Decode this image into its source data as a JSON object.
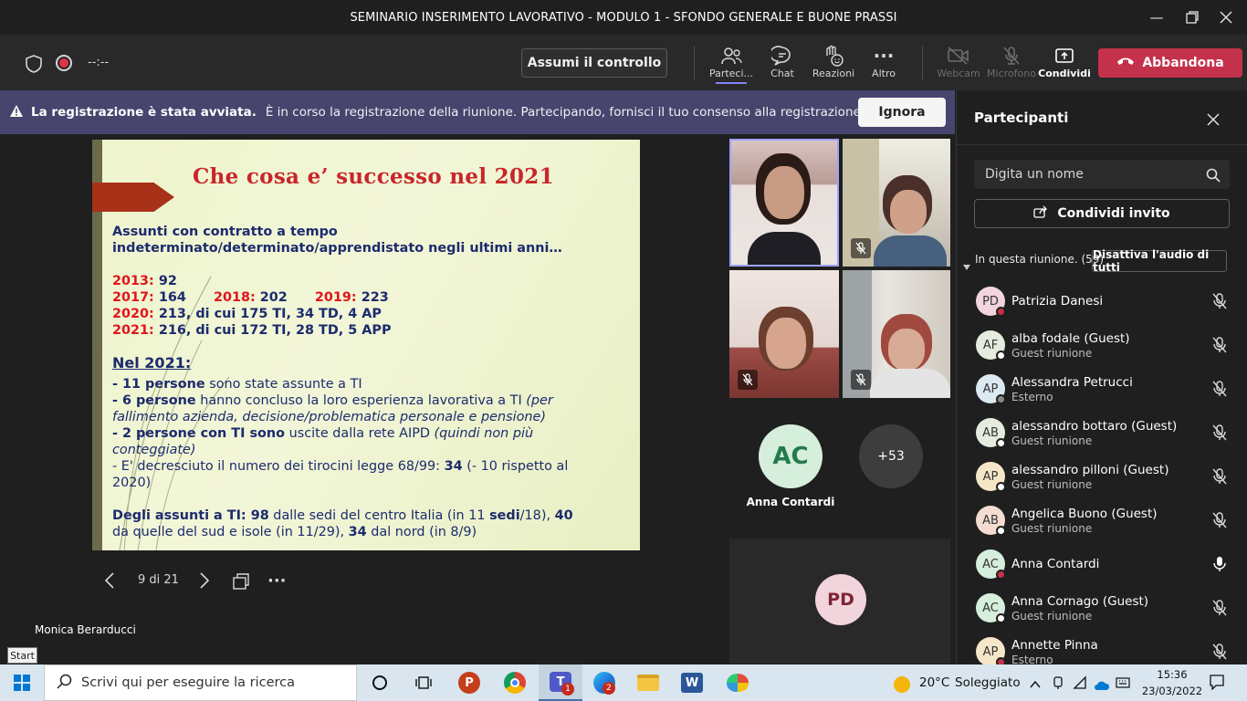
{
  "window": {
    "title": "SEMINARIO INSERIMENTO LAVORATIVO - MODULO 1 - SFONDO GENERALE E BUONE PRASSI"
  },
  "toolbar": {
    "timer": "--:--",
    "take_control": "Assumi il controllo",
    "participants": "Parteci...",
    "chat": "Chat",
    "reactions": "Reazioni",
    "more": "Altro",
    "webcam": "Webcam",
    "mic": "Microfono",
    "share": "Condividi",
    "leave": "Abbandona"
  },
  "banner": {
    "bold": "La registrazione è stata avviata.",
    "text": "È in corso la registrazione della riunione. Partecipando, fornisci il tuo consenso alla registrazione della riuni...",
    "dismiss": "Ignora"
  },
  "slide": {
    "title": "Che cosa e’ successo nel 2021",
    "intro1": "Assunti con contratto a tempo",
    "intro2": "indeterminato/determinato/apprendistato  negli ultimi anni…",
    "y2013": "2013:",
    "v2013": " 92",
    "y2017": "2017:",
    "v2017": " 164",
    "y2018": "2018:",
    "v2018": " 202",
    "y2019": "2019:",
    "v2019": " 223",
    "y2020": "2020:",
    "v2020": " 213, di cui 175 TI, 34 TD, 4 AP",
    "y2021": "2021:",
    "v2021": " 216, di cui 172 TI, 28 TD, 5 APP",
    "nel2021": "Nel 2021:",
    "l1a": "- 11 persone",
    "l1b": " sono state assunte a TI",
    "l2a": "- 6 persone",
    "l2b": " hanno concluso la loro esperienza lavorativa a TI ",
    "l2c": "(per",
    "l3": "fallimento azienda, decisione/problematica personale e pensione)",
    "l4a": "- 2 persone con TI sono",
    "l4b": " uscite dalla rete AIPD ",
    "l4c": "(quindi non più",
    "l5": "conteggiate)",
    "l6a": "- E' decresciuto il numero dei tirocini legge 68/99: ",
    "l6b": "34",
    "l6c": " (- 10 rispetto al",
    "l7": "2020)",
    "l8a": "Degli assunti a TI:",
    "l8b": "  98",
    "l8c": " dalle sedi del centro Italia (in 11 ",
    "l8d": "sedi",
    "l8e": "/18), ",
    "l8f": "40",
    "l9a": "da quelle del sud e isole (in 11/29), ",
    "l9b": "34",
    "l9c": " dal nord (in 8/9)"
  },
  "slide_controls": {
    "page": "9 di 21"
  },
  "presenter": "Monica Berarducci",
  "start_tooltip": "Start",
  "tiles": {
    "anna_initials": "AC",
    "anna_name": "Anna Contardi",
    "more": "+53",
    "pd_initials": "PD"
  },
  "panel": {
    "title": "Partecipanti",
    "search_placeholder": "Digita un nome",
    "invite": "Condividi invito",
    "in_meeting": "In questa riunione. (59)",
    "mute_all": "Disattiva l'audio di tutti",
    "people": [
      {
        "initials": "PD",
        "name": "Patrizia Danesi",
        "sub": "",
        "avatar": "#f2d5dc",
        "dot": "#c4314b",
        "mic": "off"
      },
      {
        "initials": "AF",
        "name": "alba fodale (Guest)",
        "sub": "Guest riunione",
        "avatar": "#e3ecdf",
        "dot": "#ffffff",
        "mic": "off"
      },
      {
        "initials": "AP",
        "name": "Alessandra Petrucci",
        "sub": "Esterno",
        "avatar": "#dbe9f1",
        "dot": "#8a8a8a",
        "mic": "off"
      },
      {
        "initials": "AB",
        "name": "alessandro bottaro (Guest)",
        "sub": "Guest riunione",
        "avatar": "#e3ecdf",
        "dot": "#ffffff",
        "mic": "off"
      },
      {
        "initials": "AP",
        "name": "alessandro pilloni (Guest)",
        "sub": "Guest riunione",
        "avatar": "#f6e6c8",
        "dot": "#ffffff",
        "mic": "off"
      },
      {
        "initials": "AB",
        "name": "Angelica Buono (Guest)",
        "sub": "Guest riunione",
        "avatar": "#f4ddd0",
        "dot": "#ffffff",
        "mic": "off"
      },
      {
        "initials": "AC",
        "name": "Anna Contardi",
        "sub": "",
        "avatar": "#d6eedc",
        "dot": "#c4314b",
        "mic": "on"
      },
      {
        "initials": "AC",
        "name": "Anna Cornago (Guest)",
        "sub": "Guest riunione",
        "avatar": "#d6eedc",
        "dot": "#ffffff",
        "mic": "off"
      },
      {
        "initials": "AP",
        "name": "Annette Pinna",
        "sub": "Esterno",
        "avatar": "#f6e6c8",
        "dot": "#c4314b",
        "mic": "off"
      }
    ]
  },
  "taskbar": {
    "search": "Scrivi qui per eseguire la ricerca",
    "teams_badge": "1",
    "edge_badge": "2",
    "temp": "20°C",
    "weather": "Soleggiato",
    "time": "15:36",
    "date": "23/03/2022"
  }
}
